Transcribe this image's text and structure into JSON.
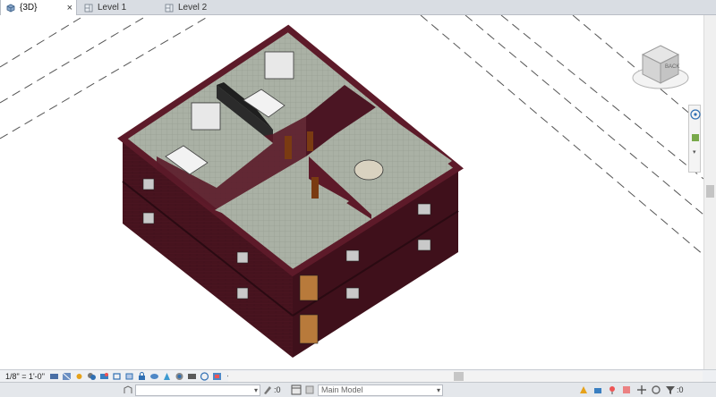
{
  "tabs": [
    {
      "label": "{3D}",
      "active": true,
      "close": "×"
    },
    {
      "label": "Level 1",
      "active": false
    },
    {
      "label": "Level 2",
      "active": false
    }
  ],
  "viewcube": {
    "face_label": "BACK"
  },
  "view_control": {
    "scale": "1/8\" = 1'-0\"",
    "collapse_arrow": "‹"
  },
  "status": {
    "workset_placeholder": "",
    "selection_count": ":0",
    "model_combo": "Main Model",
    "filter_count": ":0"
  },
  "colors": {
    "wall": "#4a1420",
    "wall_top": "#5d1a29",
    "floor": "#a9b0a3",
    "accent": "#2f6fb3"
  }
}
